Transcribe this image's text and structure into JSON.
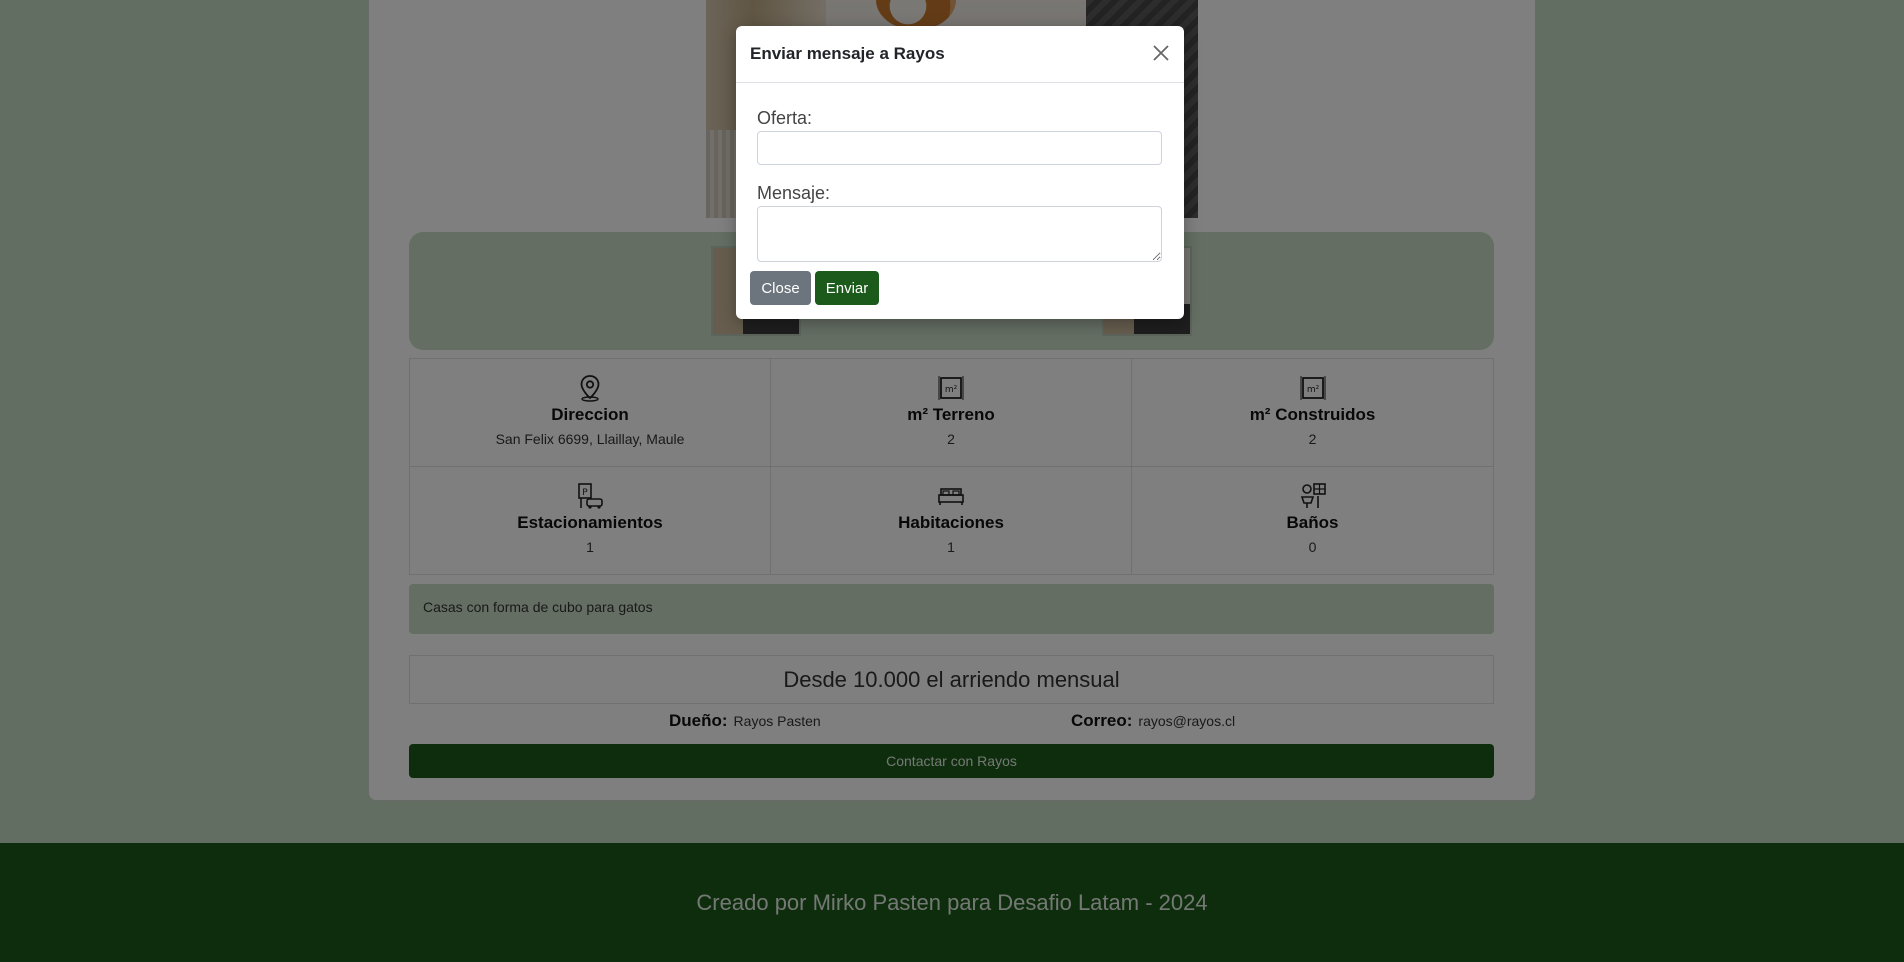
{
  "modal": {
    "title": "Enviar mensaje a Rayos",
    "oferta_label": "Oferta:",
    "oferta_value": "",
    "mensaje_label": "Mensaje:",
    "mensaje_value": "",
    "close_label": "Close",
    "send_label": "Enviar"
  },
  "features": [
    {
      "icon": "location-pin-icon",
      "title": "Direccion",
      "value": "San Felix 6699, Llaillay, Maule"
    },
    {
      "icon": "land-area-icon",
      "title": "m² Terreno",
      "value": "2"
    },
    {
      "icon": "built-area-icon",
      "title": "m² Construidos",
      "value": "2"
    },
    {
      "icon": "parking-icon",
      "title": "Estacionamientos",
      "value": "1"
    },
    {
      "icon": "bed-icon",
      "title": "Habitaciones",
      "value": "1"
    },
    {
      "icon": "bathroom-icon",
      "title": "Baños",
      "value": "0"
    }
  ],
  "description": "Casas con forma de cubo para gatos",
  "price": "Desde 10.000 el arriendo mensual",
  "owner": {
    "label": "Dueño:",
    "name": "Rayos Pasten"
  },
  "correo": {
    "label": "Correo:",
    "email": "rayos@rayos.cl"
  },
  "contact_button": "Contactar con Rayos",
  "footer": "Creado por Mirko Pasten para Desafio Latam - 2024",
  "colors": {
    "accent": "#1c5a1b",
    "panel": "#c8ddc6",
    "secondary_button": "#6c757d"
  }
}
